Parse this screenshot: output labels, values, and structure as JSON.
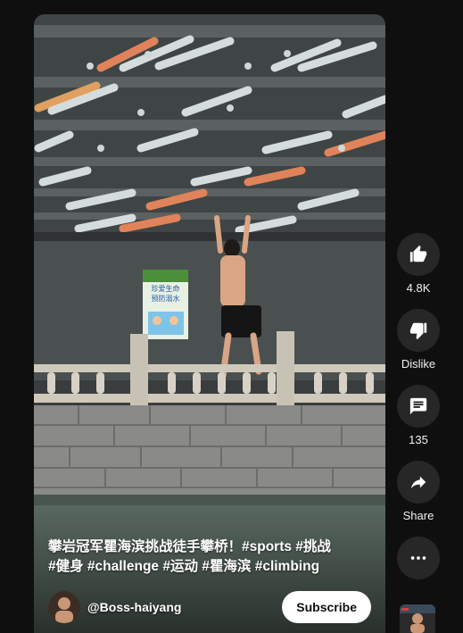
{
  "video": {
    "caption_line1": "攀岩冠军瞿海滨挑战徒手攀桥！#sports #挑战",
    "caption_line2": "#健身 #challenge #运动 #瞿海滨 #climbing",
    "sign_line1": "珍爱生命",
    "sign_line2": "预防溺水"
  },
  "channel": {
    "handle": "@Boss-haiyang",
    "subscribe_label": "Subscribe"
  },
  "actions": {
    "like": {
      "icon": "thumb-up-icon",
      "label": "4.8K"
    },
    "dislike": {
      "icon": "thumb-down-icon",
      "label": "Dislike"
    },
    "comments": {
      "icon": "comment-icon",
      "label": "135"
    },
    "share": {
      "icon": "share-icon",
      "label": "Share"
    },
    "more": {
      "icon": "more-horizontal-icon"
    }
  },
  "colors": {
    "background": "#0f0f0f",
    "action_button": "#272727",
    "subscribe_bg": "#ffffff"
  }
}
